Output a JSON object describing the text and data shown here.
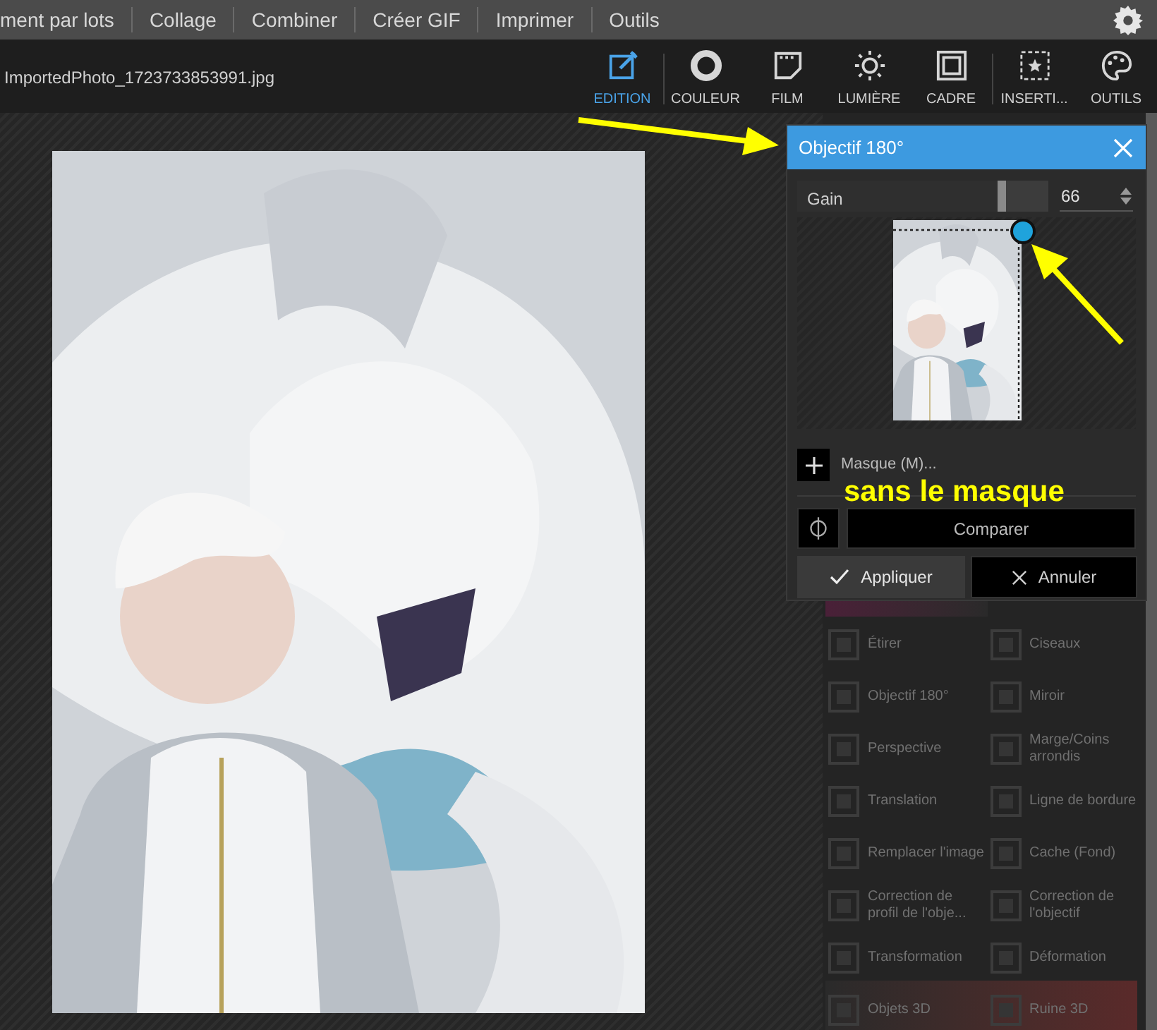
{
  "menu": [
    "ment par lots",
    "Collage",
    "Combiner",
    "Créer GIF",
    "Imprimer",
    "Outils"
  ],
  "file_name": "ImportedPhoto_1723733853991.jpg",
  "tabs": [
    {
      "label": "EDITION",
      "selected": true
    },
    {
      "label": "COULEUR",
      "selected": false
    },
    {
      "label": "FILM",
      "selected": false
    },
    {
      "label": "LUMIÈRE",
      "selected": false
    },
    {
      "label": "CADRE",
      "selected": false
    },
    {
      "label": "INSERTI...",
      "selected": false
    },
    {
      "label": "OUTILS",
      "selected": false
    }
  ],
  "tools": [
    {
      "label": "Étirer"
    },
    {
      "label": "Ciseaux"
    },
    {
      "label": "Objectif 180°"
    },
    {
      "label": "Miroir"
    },
    {
      "label": "Perspective"
    },
    {
      "label": "Marge/Coins arrondis"
    },
    {
      "label": "Translation"
    },
    {
      "label": "Ligne de bordure"
    },
    {
      "label": "Remplacer l'image"
    },
    {
      "label": "Cache (Fond)"
    },
    {
      "label": "Correction de profil de l'obje..."
    },
    {
      "label": "Correction de l'objectif"
    },
    {
      "label": "Transformation"
    },
    {
      "label": "Déformation"
    },
    {
      "label": "Objets 3D"
    },
    {
      "label": "Ruine 3D"
    }
  ],
  "dialog": {
    "title": "Objectif 180°",
    "gain": {
      "label": "Gain",
      "level": 0.83,
      "value": "66"
    },
    "mask_button": "Masque (M)...",
    "compare": "Comparer",
    "apply": "Appliquer",
    "cancel": "Annuler"
  },
  "annotation": "sans le masque"
}
